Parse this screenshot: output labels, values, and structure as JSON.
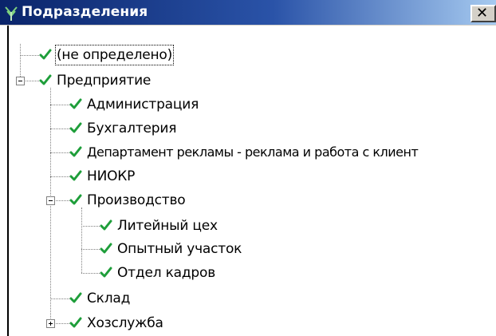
{
  "window": {
    "title": "Подразделения",
    "close_glyph": "✕"
  },
  "icons": {
    "title": "tree-icon",
    "check": "checkmark-icon",
    "collapse": "minus-expander-icon",
    "expand": "plus-expander-icon"
  },
  "colors": {
    "titlebar_start": "#0a246a",
    "titlebar_end": "#a6caf0",
    "check": "#1e9e3a"
  },
  "tree": {
    "nodes": [
      {
        "label": "(не определено)",
        "selected": true
      },
      {
        "label": "Предприятие",
        "expanded": true
      },
      {
        "label": "Администрация"
      },
      {
        "label": "Бухгалтерия"
      },
      {
        "label": "Департамент рекламы - реклама и работа с клиент"
      },
      {
        "label": "НИОКР"
      },
      {
        "label": "Производство",
        "expanded": true
      },
      {
        "label": "Литейный цех"
      },
      {
        "label": "Опытный участок"
      },
      {
        "label": "Отдел кадров"
      },
      {
        "label": "Склад"
      },
      {
        "label": "Хозслужба",
        "expanded": false
      }
    ]
  }
}
